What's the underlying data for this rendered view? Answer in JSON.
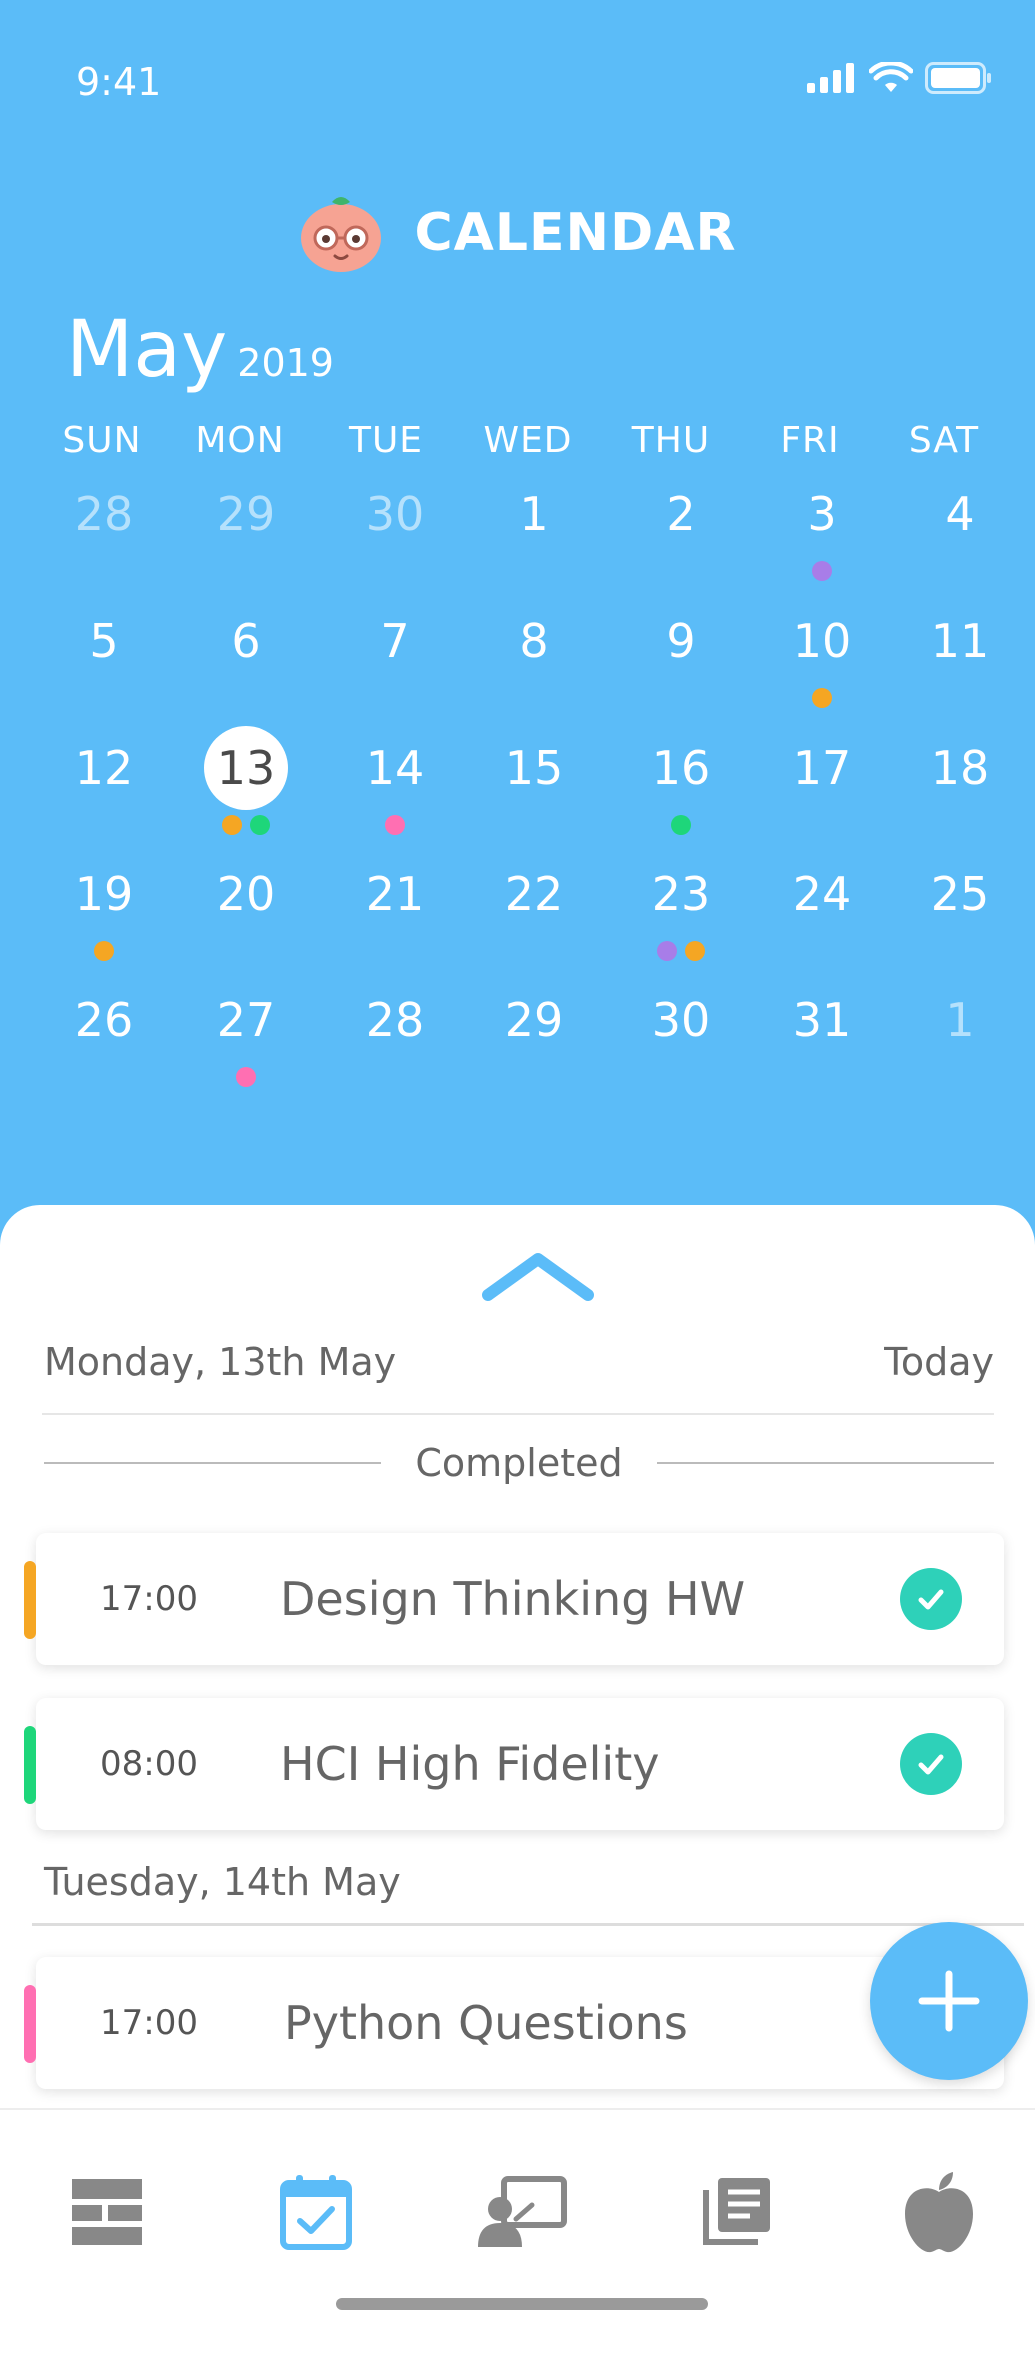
{
  "status_bar": {
    "time": "9:41"
  },
  "header": {
    "title": "CALENDAR"
  },
  "calendar": {
    "month": "May",
    "year": "2019",
    "weekdays": [
      "SUN",
      "MON",
      "TUE",
      "WED",
      "THU",
      "FRI",
      "SAT"
    ],
    "weeks": [
      [
        "28",
        "29",
        "30",
        "1",
        "2",
        "3",
        "4"
      ],
      [
        "5",
        "6",
        "7",
        "8",
        "9",
        "10",
        "11"
      ],
      [
        "12",
        "13",
        "14",
        "15",
        "16",
        "17",
        "18"
      ],
      [
        "19",
        "20",
        "21",
        "22",
        "23",
        "24",
        "25"
      ],
      [
        "26",
        "27",
        "28",
        "29",
        "30",
        "31",
        "1"
      ]
    ],
    "muted_days": [
      [
        0,
        0
      ],
      [
        0,
        1
      ],
      [
        0,
        2
      ],
      [
        4,
        6
      ]
    ],
    "selected_day": [
      2,
      1
    ],
    "events": [
      {
        "week": 0,
        "day": 5,
        "colors": [
          "purple"
        ]
      },
      {
        "week": 1,
        "day": 5,
        "colors": [
          "orange"
        ]
      },
      {
        "week": 2,
        "day": 1,
        "colors": [
          "orange",
          "green"
        ]
      },
      {
        "week": 2,
        "day": 2,
        "colors": [
          "pink"
        ]
      },
      {
        "week": 2,
        "day": 4,
        "colors": [
          "green"
        ]
      },
      {
        "week": 3,
        "day": 0,
        "colors": [
          "orange"
        ]
      },
      {
        "week": 3,
        "day": 4,
        "colors": [
          "purple",
          "orange"
        ]
      },
      {
        "week": 4,
        "day": 1,
        "colors": [
          "pink"
        ]
      }
    ]
  },
  "colors": {
    "primary": "#5bbcf8",
    "orange": "#f5a623",
    "green": "#1ed67a",
    "pink": "#ff6fb2",
    "purple": "#a87de8",
    "check": "#2ed1b9"
  },
  "agenda": {
    "date_label": "Monday, 13th May",
    "today_label": "Today",
    "completed_label": "Completed",
    "tasks": [
      {
        "time": "17:00",
        "title": "Design Thinking HW",
        "color": "orange",
        "done": true
      },
      {
        "time": "08:00",
        "title": "HCI High Fidelity",
        "color": "green",
        "done": true
      }
    ],
    "next_date_label": "Tuesday, 14th May",
    "next_tasks": [
      {
        "time": "17:00",
        "title": "Python Questions",
        "color": "pink",
        "done": false
      }
    ]
  },
  "tabbar": {
    "items": [
      "dashboard-icon",
      "calendar-check-icon",
      "presentation-icon",
      "notes-icon",
      "apple-icon"
    ],
    "active_index": 1
  }
}
